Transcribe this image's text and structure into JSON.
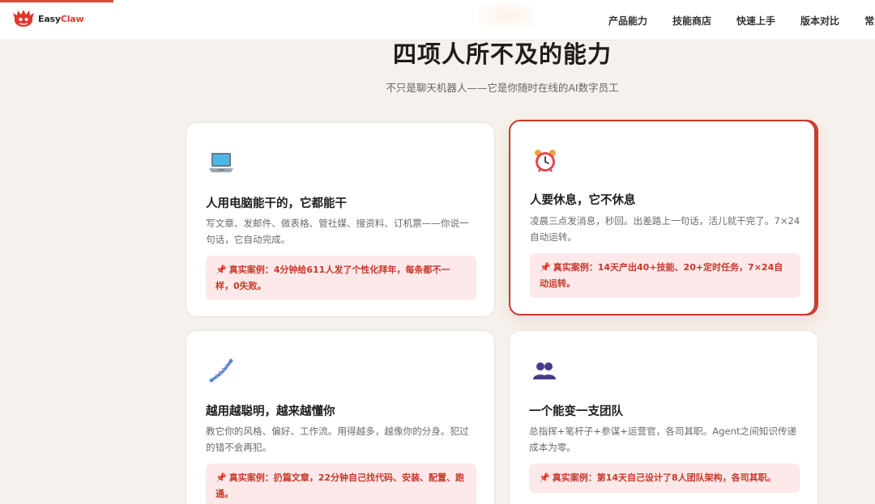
{
  "brand": {
    "name_part1": "Easy",
    "name_part2": "Claw"
  },
  "nav": {
    "items": [
      "产品能力",
      "技能商店",
      "快速上手",
      "版本对比",
      "常见"
    ]
  },
  "section": {
    "title": "四项人所不及的能力",
    "subtitle": "不只是聊天机器人——它是你随时在线的AI数字员工"
  },
  "cards": [
    {
      "icon": "laptop-icon",
      "title": "人用电脑能干的，它都能干",
      "desc": "写文章、发邮件、做表格、管社媒、搜资料、订机票——你说一句话，它自动完成。",
      "case_prefix": "📌",
      "case": "真实案例：4分钟给611人发了个性化拜年，每条都不一样，0失败。"
    },
    {
      "icon": "alarm-clock-icon",
      "title": "人要休息，它不休息",
      "desc": "凌晨三点发消息，秒回。出差路上一句话，活儿就干完了。7×24自动运转。",
      "case_prefix": "📌",
      "case": "真实案例：14天产出40+技能、20+定时任务，7×24自动运转。"
    },
    {
      "icon": "dna-icon",
      "title": "越用越聪明，越来越懂你",
      "desc": "教它你的风格、偏好、工作流。用得越多，越像你的分身。犯过的错不会再犯。",
      "case_prefix": "📌",
      "case": "真实案例：扔篇文章，22分钟自己找代码、安装、配置、跑通。"
    },
    {
      "icon": "team-icon",
      "title": "一个能变一支团队",
      "desc": "总指挥+笔杆子+参谋+运营官，各司其职。Agent之间知识传递成本为零。",
      "case_prefix": "📌",
      "case": "真实案例：第14天自己设计了8人团队架构，各司其职。"
    }
  ],
  "colors": {
    "accent": "#c93a2c",
    "case_bg": "#fde9e9",
    "page_bg": "#f6f1ec"
  }
}
